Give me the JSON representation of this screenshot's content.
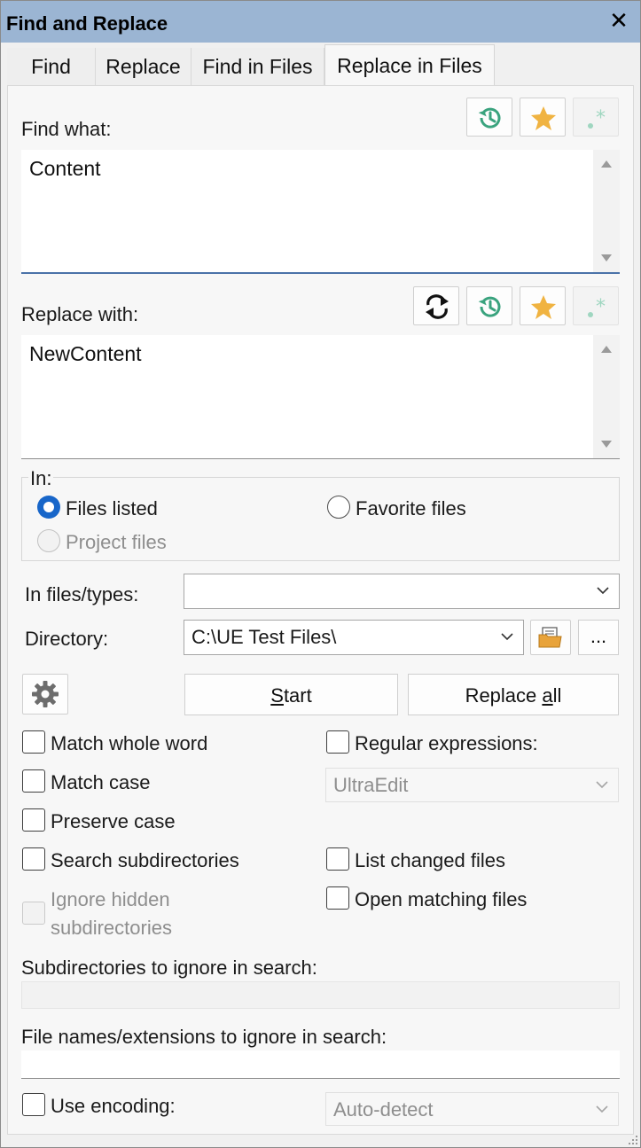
{
  "window": {
    "title": "Find and Replace",
    "close_glyph": "✕"
  },
  "tabs": [
    "Find",
    "Replace",
    "Find in Files",
    "Replace in Files"
  ],
  "active_tab": "Replace in Files",
  "find": {
    "label": "Find what:",
    "value": "Content"
  },
  "replace": {
    "label": "Replace with:",
    "value": "NewContent"
  },
  "in_group": {
    "label": "In:",
    "files_listed": "Files listed",
    "favorite_files": "Favorite files",
    "project_files": "Project files"
  },
  "file_types": {
    "label": "In files/types:",
    "value": ""
  },
  "directory": {
    "label": "Directory:",
    "value": "C:\\UE Test Files\\",
    "more_label": "..."
  },
  "actions": {
    "start": "Start",
    "start_mnemonic": "S",
    "start_rest": "tart",
    "replace_all_pre": "Replace ",
    "replace_all_mnemonic": "a",
    "replace_all_rest": "ll"
  },
  "options": {
    "match_whole_word": "Match whole word",
    "match_case": "Match case",
    "preserve_case": "Preserve case",
    "search_subdirectories": "Search subdirectories",
    "ignore_hidden_1": "Ignore hidden",
    "ignore_hidden_2": "subdirectories",
    "regular_expressions": "Regular expressions:",
    "regex_engine": "UltraEdit",
    "list_changed_files": "List changed files",
    "open_matching_files": "Open matching files"
  },
  "ignore": {
    "subdirs_label": "Subdirectories to ignore in search:",
    "subdirs_value": "",
    "files_label": "File names/extensions to ignore in search:",
    "files_value": ""
  },
  "encoding": {
    "label": "Use encoding:",
    "value": "Auto-detect"
  },
  "icons": [
    "history-icon",
    "favorite-star-icon",
    "regex-icon",
    "swap-icon",
    "folder-browse-icon",
    "gear-icon",
    "chevron-down-icon",
    "close-icon"
  ],
  "colors": {
    "titlebar": "#9bb5d3",
    "accent": "#1866c9",
    "history": "#3aa37e",
    "star": "#f0b341"
  }
}
